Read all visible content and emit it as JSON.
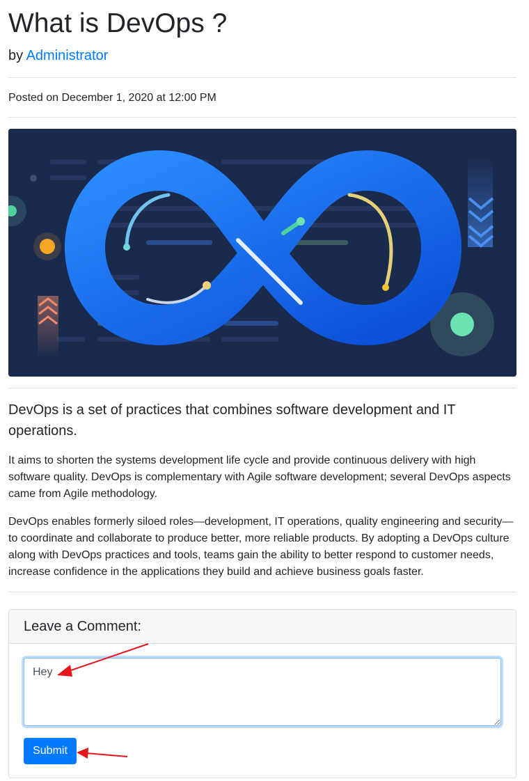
{
  "post": {
    "title": "What is DevOps ?",
    "by_prefix": "by",
    "author": "Administrator",
    "posted": "Posted on December 1, 2020 at 12:00 PM",
    "lead": "DevOps is a set of practices that combines software development and IT operations.",
    "paragraphs": [
      "It aims to shorten the systems development life cycle and provide continuous delivery with high software quality. DevOps is complementary with Agile software development; several DevOps aspects came from Agile methodology.",
      "DevOps enables formerly siloed roles—development, IT operations, quality engineering and security—to coordinate and collaborate to produce better, more reliable products. By adopting a DevOps culture along with DevOps practices and tools, teams gain the ability to better respond to customer needs, increase confidence in the applications they build and achieve business goals faster."
    ]
  },
  "hero": {
    "icon": "devops-infinity-loop-illustration",
    "background": "#1a2a4c",
    "accent": "#1a6cf0"
  },
  "comment": {
    "header": "Leave a Comment:",
    "value": "Hey",
    "submit_label": "Submit"
  },
  "colors": {
    "link": "#007bff",
    "button": "#007bff",
    "annotation_arrow": "#e8141c"
  }
}
